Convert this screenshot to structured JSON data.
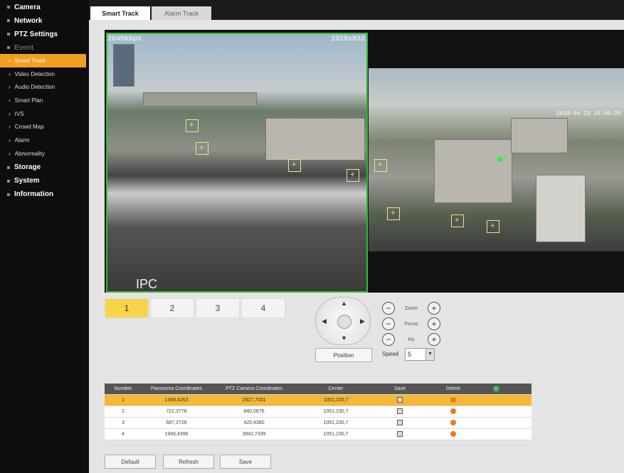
{
  "sidebar": {
    "items": [
      {
        "label": "Camera",
        "type": "main"
      },
      {
        "label": "Network",
        "type": "main"
      },
      {
        "label": "PTZ Settings",
        "type": "main"
      },
      {
        "label": "Event",
        "type": "main-dim"
      },
      {
        "label": "Smart Track",
        "type": "sub",
        "active": true
      },
      {
        "label": "Video Detection",
        "type": "sub"
      },
      {
        "label": "Audio Detection",
        "type": "sub"
      },
      {
        "label": "Smart Plan",
        "type": "sub"
      },
      {
        "label": "IVS",
        "type": "sub"
      },
      {
        "label": "Crowd Map",
        "type": "sub"
      },
      {
        "label": "Alarm",
        "type": "sub"
      },
      {
        "label": "Abnormality",
        "type": "sub"
      },
      {
        "label": "Storage",
        "type": "main"
      },
      {
        "label": "System",
        "type": "main"
      },
      {
        "label": "Information",
        "type": "main"
      }
    ]
  },
  "tabs": [
    {
      "label": "Smart Track",
      "active": true
    },
    {
      "label": "Alarm Track",
      "active": false
    }
  ],
  "video": {
    "bitrate": "2045Kbps",
    "resolution": "1920x832",
    "timestamp": "2019-04-23 15:50:25",
    "ipc_label": "IPC"
  },
  "presets": [
    "1",
    "2",
    "3",
    "4"
  ],
  "ptz": {
    "position_label": "Position",
    "zoom_label": "Zoom",
    "focus_label": "Focus",
    "iris_label": "Iris",
    "speed_label": "Speed",
    "speed_value": "5"
  },
  "table": {
    "headers": [
      "Number",
      "Panorama Coordinates",
      "PTZ Camera Coordinates",
      "Center",
      "Save",
      "Delete"
    ],
    "rows": [
      {
        "number": "1",
        "pano": "1469,4263",
        "ptz": "2827,7031",
        "center": "1051,230,7",
        "selected": true
      },
      {
        "number": "2",
        "pano": "722,3778",
        "ptz": "840,0676",
        "center": "1051,230,7",
        "selected": false
      },
      {
        "number": "3",
        "pano": "687,2726",
        "ptz": "420,4380",
        "center": "1051,230,7",
        "selected": false
      },
      {
        "number": "4",
        "pano": "1946,4396",
        "ptz": "3942,7339",
        "center": "1051,230,7",
        "selected": false
      }
    ]
  },
  "buttons": {
    "default": "Default",
    "refresh": "Refresh",
    "save": "Save"
  }
}
